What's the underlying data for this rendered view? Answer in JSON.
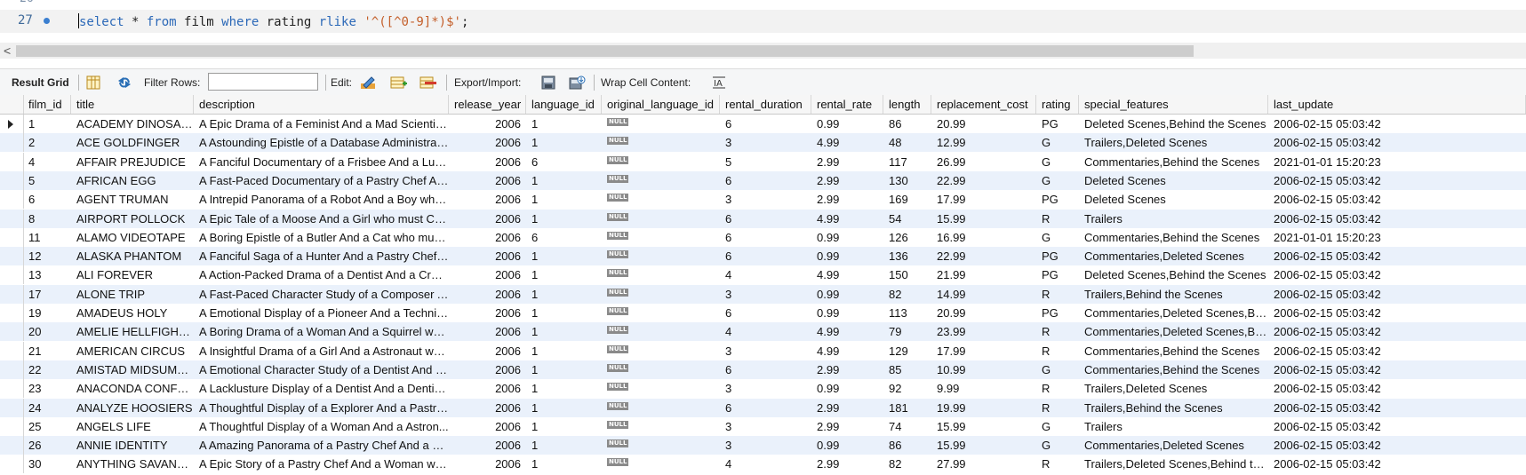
{
  "editor": {
    "prev_line_num": "26",
    "line_num": "27",
    "code_tokens": [
      {
        "t": "select",
        "c": "kw"
      },
      {
        "t": " * ",
        "c": "plain"
      },
      {
        "t": "from",
        "c": "kw"
      },
      {
        "t": " film ",
        "c": "plain"
      },
      {
        "t": "where",
        "c": "kw"
      },
      {
        "t": " rating ",
        "c": "plain"
      },
      {
        "t": "rlike",
        "c": "kw"
      },
      {
        "t": " ",
        "c": "plain"
      },
      {
        "t": "'^([^0-9]*)$'",
        "c": "str"
      },
      {
        "t": ";",
        "c": "plain"
      }
    ],
    "scroll_left_arrow": "<"
  },
  "toolbar": {
    "result_grid": "Result Grid",
    "filter_rows": "Filter Rows:",
    "filter_value": "",
    "edit": "Edit:",
    "export_import": "Export/Import:",
    "wrap_cell": "Wrap Cell Content:"
  },
  "grid": {
    "columns": [
      "film_id",
      "title",
      "description",
      "release_year",
      "language_id",
      "original_language_id",
      "rental_duration",
      "rental_rate",
      "length",
      "replacement_cost",
      "rating",
      "special_features",
      "last_update"
    ],
    "null_label": "NULL",
    "rows": [
      [
        "1",
        "ACADEMY DINOSAUR",
        "A Epic Drama of a Feminist And a Mad Scientist ...",
        "2006",
        "1",
        "NULL",
        "6",
        "0.99",
        "86",
        "20.99",
        "PG",
        "Deleted Scenes,Behind the Scenes",
        "2006-02-15 05:03:42"
      ],
      [
        "2",
        "ACE GOLDFINGER",
        "A Astounding Epistle of a Database Administrat...",
        "2006",
        "1",
        "NULL",
        "3",
        "4.99",
        "48",
        "12.99",
        "G",
        "Trailers,Deleted Scenes",
        "2006-02-15 05:03:42"
      ],
      [
        "4",
        "AFFAIR PREJUDICE",
        "A Fanciful Documentary of a Frisbee And a Lum...",
        "2006",
        "6",
        "NULL",
        "5",
        "2.99",
        "117",
        "26.99",
        "G",
        "Commentaries,Behind the Scenes",
        "2021-01-01 15:20:23"
      ],
      [
        "5",
        "AFRICAN EGG",
        "A Fast-Paced Documentary of a Pastry Chef An...",
        "2006",
        "1",
        "NULL",
        "6",
        "2.99",
        "130",
        "22.99",
        "G",
        "Deleted Scenes",
        "2006-02-15 05:03:42"
      ],
      [
        "6",
        "AGENT TRUMAN",
        "A Intrepid Panorama of a Robot And a Boy who...",
        "2006",
        "1",
        "NULL",
        "3",
        "2.99",
        "169",
        "17.99",
        "PG",
        "Deleted Scenes",
        "2006-02-15 05:03:42"
      ],
      [
        "8",
        "AIRPORT POLLOCK",
        "A Epic Tale of a Moose And a Girl who must Con...",
        "2006",
        "1",
        "NULL",
        "6",
        "4.99",
        "54",
        "15.99",
        "R",
        "Trailers",
        "2006-02-15 05:03:42"
      ],
      [
        "11",
        "ALAMO VIDEOTAPE",
        "A Boring Epistle of a Butler And a Cat who must ...",
        "2006",
        "6",
        "NULL",
        "6",
        "0.99",
        "126",
        "16.99",
        "G",
        "Commentaries,Behind the Scenes",
        "2021-01-01 15:20:23"
      ],
      [
        "12",
        "ALASKA PHANTOM",
        "A Fanciful Saga of a Hunter And a Pastry Chef ...",
        "2006",
        "1",
        "NULL",
        "6",
        "0.99",
        "136",
        "22.99",
        "PG",
        "Commentaries,Deleted Scenes",
        "2006-02-15 05:03:42"
      ],
      [
        "13",
        "ALI FOREVER",
        "A Action-Packed Drama of a Dentist And a Croc...",
        "2006",
        "1",
        "NULL",
        "4",
        "4.99",
        "150",
        "21.99",
        "PG",
        "Deleted Scenes,Behind the Scenes",
        "2006-02-15 05:03:42"
      ],
      [
        "17",
        "ALONE TRIP",
        "A Fast-Paced Character Study of a Composer A...",
        "2006",
        "1",
        "NULL",
        "3",
        "0.99",
        "82",
        "14.99",
        "R",
        "Trailers,Behind the Scenes",
        "2006-02-15 05:03:42"
      ],
      [
        "19",
        "AMADEUS HOLY",
        "A Emotional Display of a Pioneer And a Technica...",
        "2006",
        "1",
        "NULL",
        "6",
        "0.99",
        "113",
        "20.99",
        "PG",
        "Commentaries,Deleted Scenes,Be...",
        "2006-02-15 05:03:42"
      ],
      [
        "20",
        "AMELIE HELLFIGHTERS",
        "A Boring Drama of a Woman And a Squirrel who...",
        "2006",
        "1",
        "NULL",
        "4",
        "4.99",
        "79",
        "23.99",
        "R",
        "Commentaries,Deleted Scenes,Be...",
        "2006-02-15 05:03:42"
      ],
      [
        "21",
        "AMERICAN CIRCUS",
        "A Insightful Drama of a Girl And a Astronaut wh...",
        "2006",
        "1",
        "NULL",
        "3",
        "4.99",
        "129",
        "17.99",
        "R",
        "Commentaries,Behind the Scenes",
        "2006-02-15 05:03:42"
      ],
      [
        "22",
        "AMISTAD MIDSUMMER",
        "A Emotional Character Study of a Dentist And a...",
        "2006",
        "1",
        "NULL",
        "6",
        "2.99",
        "85",
        "10.99",
        "G",
        "Commentaries,Behind the Scenes",
        "2006-02-15 05:03:42"
      ],
      [
        "23",
        "ANACONDA CONFES...",
        "A Lacklusture Display of a Dentist And a Dentist...",
        "2006",
        "1",
        "NULL",
        "3",
        "0.99",
        "92",
        "9.99",
        "R",
        "Trailers,Deleted Scenes",
        "2006-02-15 05:03:42"
      ],
      [
        "24",
        "ANALYZE HOOSIERS",
        "A Thoughtful Display of a Explorer And a Pastry...",
        "2006",
        "1",
        "NULL",
        "6",
        "2.99",
        "181",
        "19.99",
        "R",
        "Trailers,Behind the Scenes",
        "2006-02-15 05:03:42"
      ],
      [
        "25",
        "ANGELS LIFE",
        "A Thoughtful Display of a Woman And a Astron...",
        "2006",
        "1",
        "NULL",
        "3",
        "2.99",
        "74",
        "15.99",
        "G",
        "Trailers",
        "2006-02-15 05:03:42"
      ],
      [
        "26",
        "ANNIE IDENTITY",
        "A Amazing Panorama of a Pastry Chef And a Bo...",
        "2006",
        "1",
        "NULL",
        "3",
        "0.99",
        "86",
        "15.99",
        "G",
        "Commentaries,Deleted Scenes",
        "2006-02-15 05:03:42"
      ],
      [
        "30",
        "ANYTHING SAVANNAH",
        "A Epic Story of a Pastry Chef And a Woman wh...",
        "2006",
        "1",
        "NULL",
        "4",
        "2.99",
        "82",
        "27.99",
        "R",
        "Trailers,Deleted Scenes,Behind th...",
        "2006-02-15 05:03:42"
      ]
    ]
  }
}
